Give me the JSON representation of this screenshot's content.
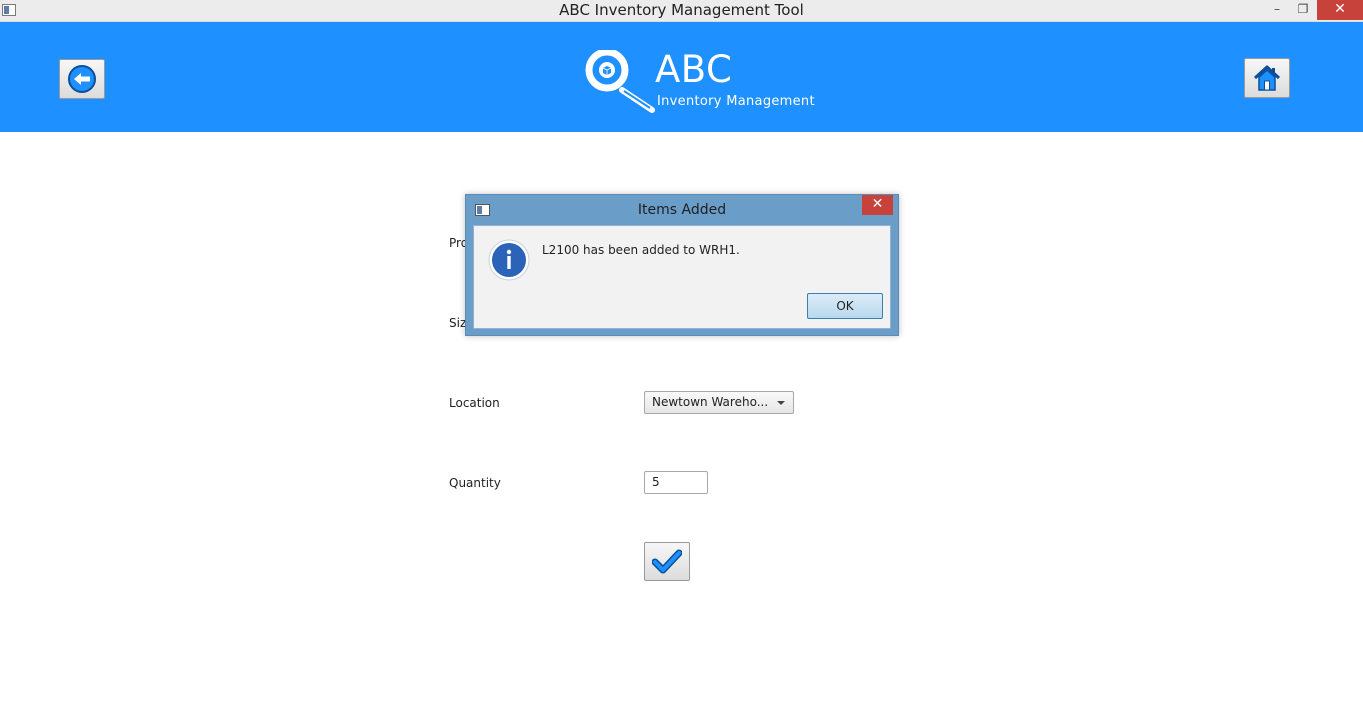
{
  "window": {
    "title": "ABC Inventory Management Tool",
    "minimize_glyph": "–",
    "maximize_glyph": "❐",
    "close_glyph": "✕"
  },
  "header": {
    "brand_name": "ABC",
    "brand_subtitle": "Inventory Management",
    "background_color": "#1e90ff",
    "back_icon": "back-arrow-icon",
    "home_icon": "home-icon"
  },
  "form": {
    "product_label": "Pro",
    "size_label": "Siz",
    "location_label": "Location",
    "location_value": "Newtown Wareho...",
    "quantity_label": "Quantity",
    "quantity_value": "5",
    "confirm_icon": "checkmark-icon"
  },
  "dialog": {
    "title": "Items Added",
    "message": "L2100 has been added to WRH1.",
    "ok_label": "OK",
    "close_glyph": "✕",
    "icon": "info-icon"
  }
}
